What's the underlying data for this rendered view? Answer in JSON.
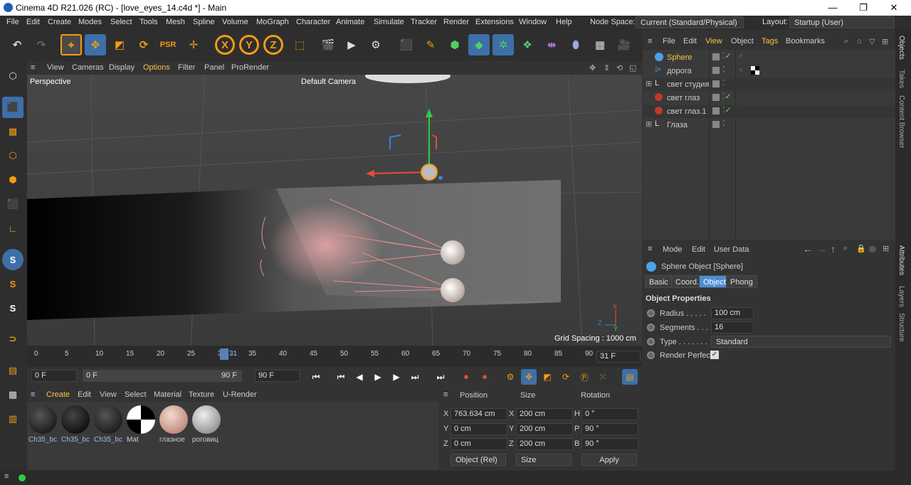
{
  "window": {
    "title": "Cinema 4D R21.026 (RC) - [love_eyes_14.c4d *] - Main",
    "min": "—",
    "restore": "❐",
    "close": "✕"
  },
  "menu": {
    "items": [
      "File",
      "Edit",
      "Create",
      "Modes",
      "Select",
      "Tools",
      "Mesh",
      "Spline",
      "Volume",
      "MoGraph",
      "Character",
      "Animate",
      "Simulate",
      "Tracker",
      "Render",
      "Extensions",
      "Window",
      "Help"
    ],
    "node_space_label": "Node Space:",
    "node_space_value": "Current (Standard/Physical)",
    "layout_label": "Layout:",
    "layout_value": "Startup (User)"
  },
  "toolbar": {
    "x": "X",
    "y": "Y",
    "z": "Z"
  },
  "viewport_menu": {
    "items": [
      "View",
      "Cameras",
      "Display",
      "Options",
      "Filter",
      "Panel",
      "ProRender"
    ]
  },
  "viewport": {
    "name": "Perspective",
    "camera": "Default Camera",
    "grid_spacing": "Grid Spacing : 1000 cm",
    "axis_x": "X",
    "axis_y": "Y",
    "axis_z": "Z"
  },
  "timeline": {
    "ticks": [
      "0",
      "5",
      "10",
      "15",
      "20",
      "25",
      "30",
      "35",
      "40",
      "45",
      "50",
      "55",
      "60",
      "65",
      "70",
      "75",
      "80",
      "85",
      "90"
    ],
    "current": "31",
    "current_field": "31 F"
  },
  "transport": {
    "start": "0 F",
    "range_start": "0 F",
    "range_end": "90 F",
    "end": "90 F"
  },
  "materials": {
    "menu": [
      "Create",
      "Edit",
      "View",
      "Select",
      "Material",
      "Texture",
      "U-Render"
    ],
    "items": [
      {
        "label": "Ch35_bc"
      },
      {
        "label": "Ch35_bc"
      },
      {
        "label": "Ch35_bc"
      },
      {
        "label": "Mat"
      },
      {
        "label": "глазное"
      },
      {
        "label": "роговиц"
      }
    ]
  },
  "coordinates": {
    "headers": {
      "position": "Position",
      "size": "Size",
      "rotation": "Rotation"
    },
    "rows": [
      {
        "axis": "X",
        "pos": "763.634 cm",
        "saxis": "X",
        "size": "200 cm",
        "raxis": "H",
        "rot": "0 °"
      },
      {
        "axis": "Y",
        "pos": "0 cm",
        "saxis": "Y",
        "size": "200 cm",
        "raxis": "P",
        "rot": "90 °"
      },
      {
        "axis": "Z",
        "pos": "0 cm",
        "saxis": "Z",
        "size": "200 cm",
        "raxis": "B",
        "rot": "90 °"
      }
    ],
    "mode": "Object (Rel)",
    "size_mode": "Size",
    "apply": "Apply"
  },
  "objects": {
    "menu": [
      "File",
      "Edit",
      "View",
      "Object",
      "Tags",
      "Bookmarks"
    ],
    "items": [
      {
        "name": "Sphere"
      },
      {
        "name": "дорога"
      },
      {
        "name": "свет студия"
      },
      {
        "name": "свет глаз"
      },
      {
        "name": "свет глаз.1"
      },
      {
        "name": "Глаза"
      }
    ]
  },
  "attributes": {
    "menu": [
      "Mode",
      "Edit",
      "User Data"
    ],
    "title": "Sphere Object [Sphere]",
    "tabs": [
      "Basic",
      "Coord.",
      "Object",
      "Phong"
    ],
    "section": "Object Properties",
    "radius_label": "Radius . . . . .",
    "radius": "100 cm",
    "segments_label": "Segments . . .",
    "segments": "16",
    "type_label": "Type . . . . . . .",
    "type": "Standard",
    "render_perfect_label": "Render Perfect"
  },
  "side_tabs": [
    "Objects",
    "Takes",
    "Content Browser",
    "Attributes",
    "Layers",
    "Structure"
  ],
  "colors": {
    "accent": "#f39c12",
    "selected": "#4b8ed8"
  }
}
